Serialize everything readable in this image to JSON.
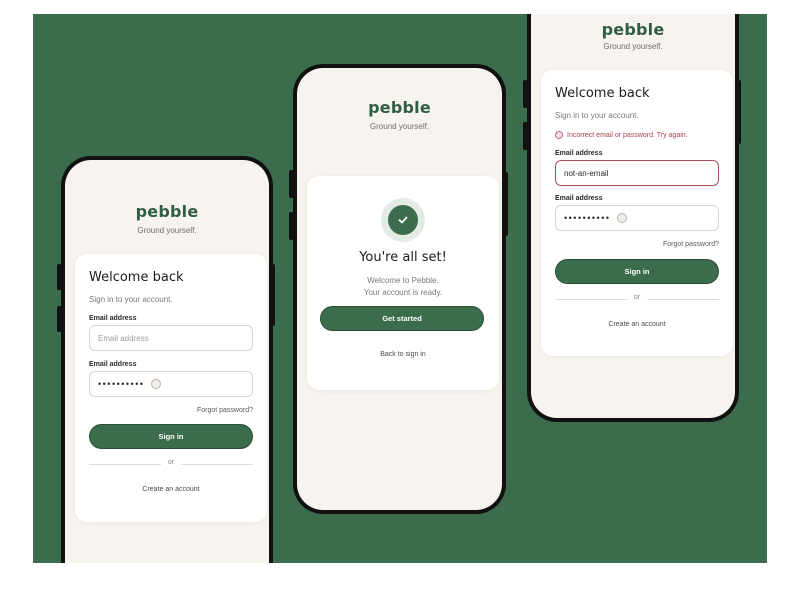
{
  "brand": {
    "name": "pebble",
    "tagline": "Ground yourself."
  },
  "colors": {
    "background": "#3b6c4b",
    "accent": "#3b6c4b",
    "error": "#a8404f"
  },
  "login_screen": {
    "title": "Welcome back",
    "subtitle": "Sign in to your account.",
    "email_label": "Email address",
    "email_placeholder": "Email address",
    "password_label": "Email address",
    "password_value": "••••••••••",
    "forgot_password": "Forgot password?",
    "sign_in_button": "Sign in",
    "divider_text": "or",
    "create_account": "Create an account"
  },
  "success_screen": {
    "icon": "checkmark-icon",
    "title": "You're all set!",
    "message_line1": "Welcome to Pebble.",
    "message_line2": "Your account is ready.",
    "get_started_button": "Get started",
    "back_link": "Back to sign in"
  },
  "error_screen": {
    "title": "Welcome back",
    "subtitle": "Sign in to your account.",
    "error_message": "Incorrect email or password. Try again.",
    "email_label": "Email address",
    "email_value": "not-an-email",
    "password_label": "Email address",
    "password_value": "••••••••••",
    "forgot_password": "Forgot password?",
    "sign_in_button": "Sign in",
    "divider_text": "or",
    "create_account": "Create an account"
  }
}
